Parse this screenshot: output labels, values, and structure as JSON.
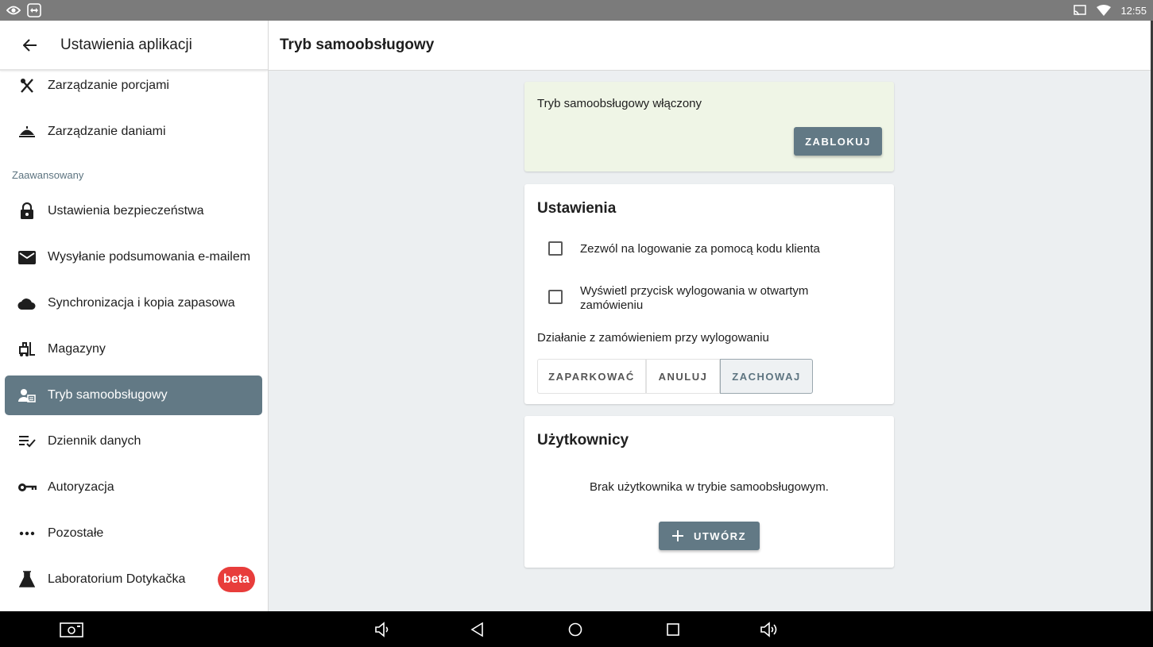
{
  "status_bar": {
    "time": "12:55"
  },
  "sidebar": {
    "title": "Ustawienia aplikacji",
    "section_label": "Zaawansowany",
    "items": [
      {
        "label": "Zarządzanie porcjami",
        "icon": "utensils-icon"
      },
      {
        "label": "Zarządzanie daniami",
        "icon": "cloche-icon"
      },
      {
        "label": "Ustawienia bezpieczeństwa",
        "icon": "lock-icon"
      },
      {
        "label": "Wysyłanie podsumowania e-mailem",
        "icon": "mail-icon"
      },
      {
        "label": "Synchronizacja i kopia zapasowa",
        "icon": "cloud-icon"
      },
      {
        "label": "Magazyny",
        "icon": "forklift-icon"
      },
      {
        "label": "Tryb samoobsługowy",
        "icon": "person-card-icon",
        "active": true
      },
      {
        "label": "Dziennik danych",
        "icon": "list-check-icon"
      },
      {
        "label": "Autoryzacja",
        "icon": "key-icon"
      },
      {
        "label": "Pozostałe",
        "icon": "more-horiz-icon"
      },
      {
        "label": "Laboratorium Dotykačka",
        "icon": "flask-icon",
        "badge": "beta"
      }
    ]
  },
  "main": {
    "title": "Tryb samoobsługowy",
    "status_card": {
      "text": "Tryb samoobsługowy włączony",
      "button": "ZABLOKUJ"
    },
    "settings_card": {
      "heading": "Ustawienia",
      "checkbox1": "Zezwól na logowanie za pomocą kodu klienta",
      "checkbox2_line1": "Wyświetl przycisk wylogowania w otwartym",
      "checkbox2_line2": "zamówieniu",
      "logout_action_label": "Działanie z zamówieniem przy wylogowaniu",
      "options": [
        "ZAPARKOWAĆ",
        "ANULUJ",
        "ZACHOWAJ"
      ],
      "selected_option": "ZACHOWAJ"
    },
    "users_card": {
      "heading": "Użytkownicy",
      "empty_text": "Brak użytkownika w trybie samoobsługowym.",
      "create_button": "UTWÓRZ"
    }
  },
  "colors": {
    "accent": "#627985",
    "badge": "#e83d3b",
    "status_bg": "#eff5e6",
    "main_bg": "#eceff1"
  }
}
